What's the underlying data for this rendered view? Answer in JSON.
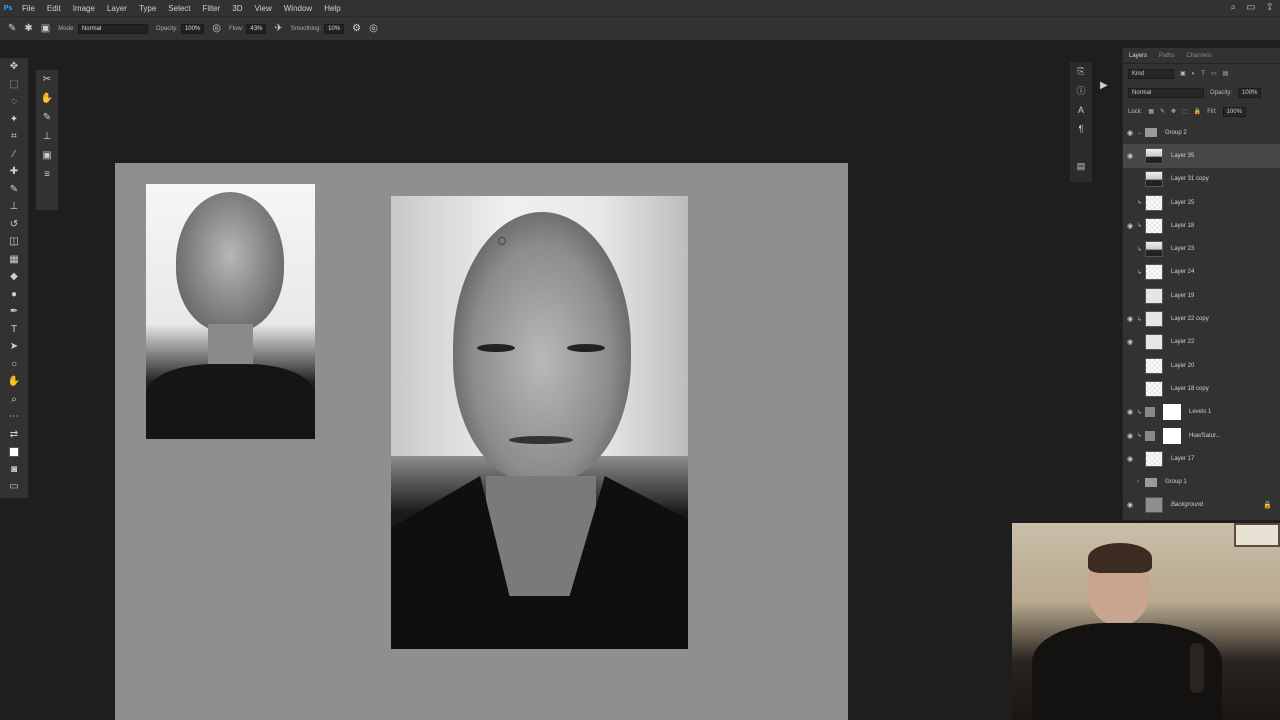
{
  "menu": [
    "File",
    "Edit",
    "Image",
    "Layer",
    "Type",
    "Select",
    "Filter",
    "3D",
    "View",
    "Window",
    "Help"
  ],
  "options": {
    "mode_label": "Mode:",
    "mode_value": "Normal",
    "opacity_label": "Opacity:",
    "opacity_value": "100%",
    "flow_label": "Flow:",
    "flow_value": "43%",
    "smoothing_label": "Smoothing:",
    "smoothing_value": "10%"
  },
  "layers_panel": {
    "tabs": [
      "Layers",
      "Paths",
      "Channels"
    ],
    "kind_label": "Kind",
    "blend_mode": "Normal",
    "opacity_label": "Opacity:",
    "opacity_value": "100%",
    "lock_label": "Lock:",
    "fill_label": "Fill:",
    "fill_value": "100%",
    "layers": [
      {
        "name": "Group 2",
        "type": "group"
      },
      {
        "name": "Layer 35",
        "type": "layer",
        "selected": true
      },
      {
        "name": "Layer 31 copy",
        "type": "layer"
      },
      {
        "name": "Layer 25",
        "type": "layer"
      },
      {
        "name": "Layer 18",
        "type": "layer"
      },
      {
        "name": "Layer 23",
        "type": "layer"
      },
      {
        "name": "Layer 24",
        "type": "layer"
      },
      {
        "name": "Layer 19",
        "type": "layer"
      },
      {
        "name": "Layer 22 copy",
        "type": "layer"
      },
      {
        "name": "Layer 22",
        "type": "layer"
      },
      {
        "name": "Layer 20",
        "type": "layer"
      },
      {
        "name": "Layer 18 copy",
        "type": "layer"
      },
      {
        "name": "Levels 1",
        "type": "adjustment"
      },
      {
        "name": "Hue/Satur...",
        "type": "adjustment"
      },
      {
        "name": "Layer 17",
        "type": "layer"
      },
      {
        "name": "Group 1",
        "type": "group"
      },
      {
        "name": "Background",
        "type": "background"
      }
    ]
  }
}
